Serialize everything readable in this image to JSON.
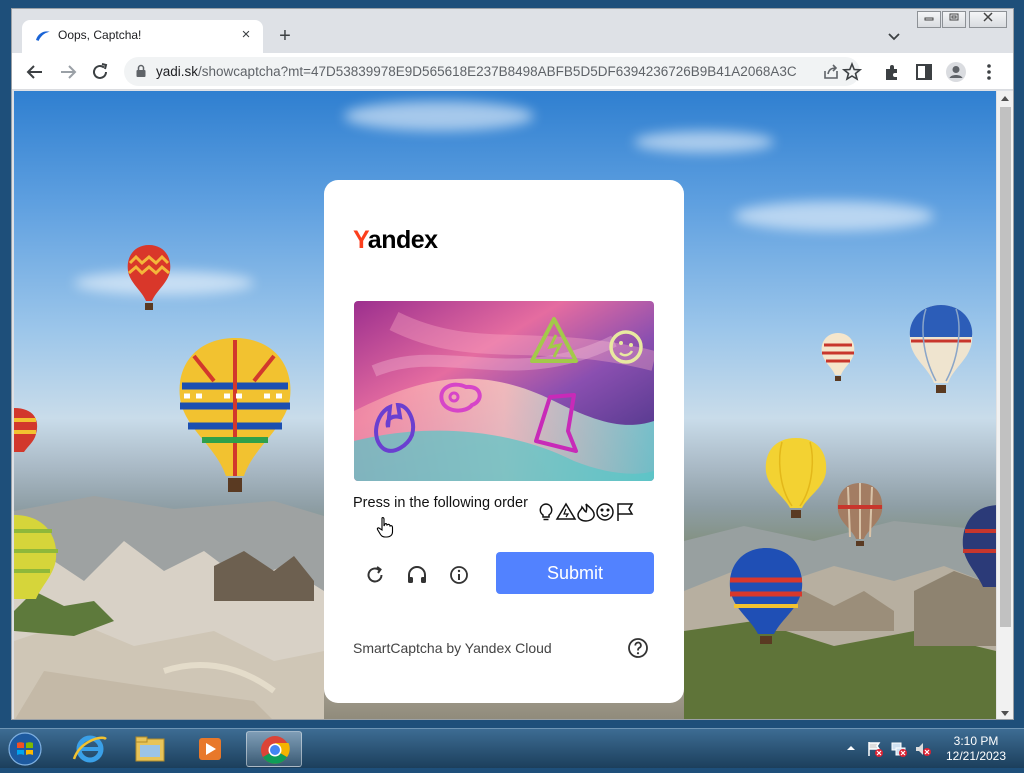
{
  "browser": {
    "tab_title": "Oops, Captcha!",
    "url_host": "yadi.sk",
    "url_rest": "/showcaptcha?mt=47D53839978E9D565618E237B8498ABFB5D5DF6394236726B9B41A2068A3C...",
    "new_tab_label": "+",
    "tab_close_label": "×",
    "window_controls": [
      "minimize",
      "restore",
      "close"
    ],
    "toolbar_icons": [
      "back-icon",
      "forward-icon",
      "reload-icon",
      "share-icon",
      "bookmark-star-icon",
      "extensions-icon",
      "side-panel-icon",
      "profile-icon",
      "menu-icon"
    ]
  },
  "captcha": {
    "logo_first": "Y",
    "logo_rest": "andex",
    "prompt": "Press in the following order",
    "order_icons": [
      "bulb-icon",
      "hazard-icon",
      "fire-icon",
      "smiley-icon",
      "flag-icon"
    ],
    "controls": [
      "refresh-icon",
      "audio-icon",
      "info-icon"
    ],
    "submit_label": "Submit",
    "footer": "SmartCaptcha by Yandex Cloud"
  },
  "taskbar": {
    "apps": [
      "internet-explorer",
      "file-explorer",
      "media-player",
      "chrome"
    ],
    "active_app": "chrome",
    "time": "3:10 PM",
    "date": "12/21/2023"
  },
  "colors": {
    "submit": "#5282ff",
    "logo_accent": "#fc3f1d"
  }
}
